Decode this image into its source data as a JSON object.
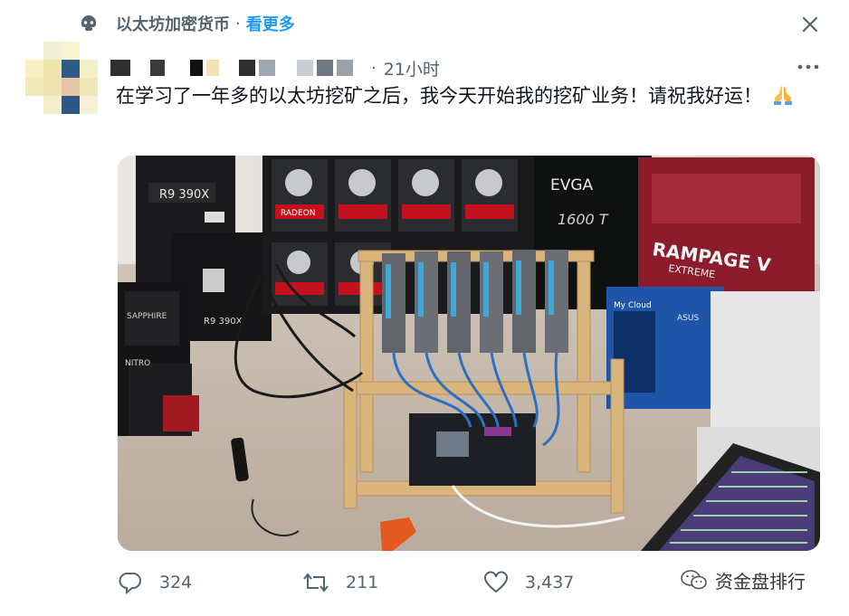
{
  "community": {
    "name": "以太坊加密货币",
    "separator": "·",
    "see_more": "看更多"
  },
  "tweet": {
    "separator": "·",
    "time": "21小时",
    "text": "在学习了一年多的以太坊挖矿之后，我今天开始我的挖矿业务！请祝我好运！",
    "emoji": "folded-hands-icon"
  },
  "photo": {
    "labels": {
      "r9": "R9 390X",
      "evga": "EVGA",
      "psu": "1600 T",
      "rampage": "RAMPAGE V",
      "extreme": "EXTREME",
      "nitro": "NITRO",
      "sapphire": "SAPPHIRE",
      "radeon": "RADEON",
      "asus": "ASUS",
      "mycloud": "My Cloud",
      "r9b": "R9 390X"
    }
  },
  "actions": {
    "replies": "324",
    "retweets": "211",
    "likes": "3,437"
  },
  "watermark": {
    "text": "资金盘排行"
  },
  "colors": {
    "accent": "#1d9bf0",
    "muted": "#536471",
    "text": "#0f1419"
  }
}
